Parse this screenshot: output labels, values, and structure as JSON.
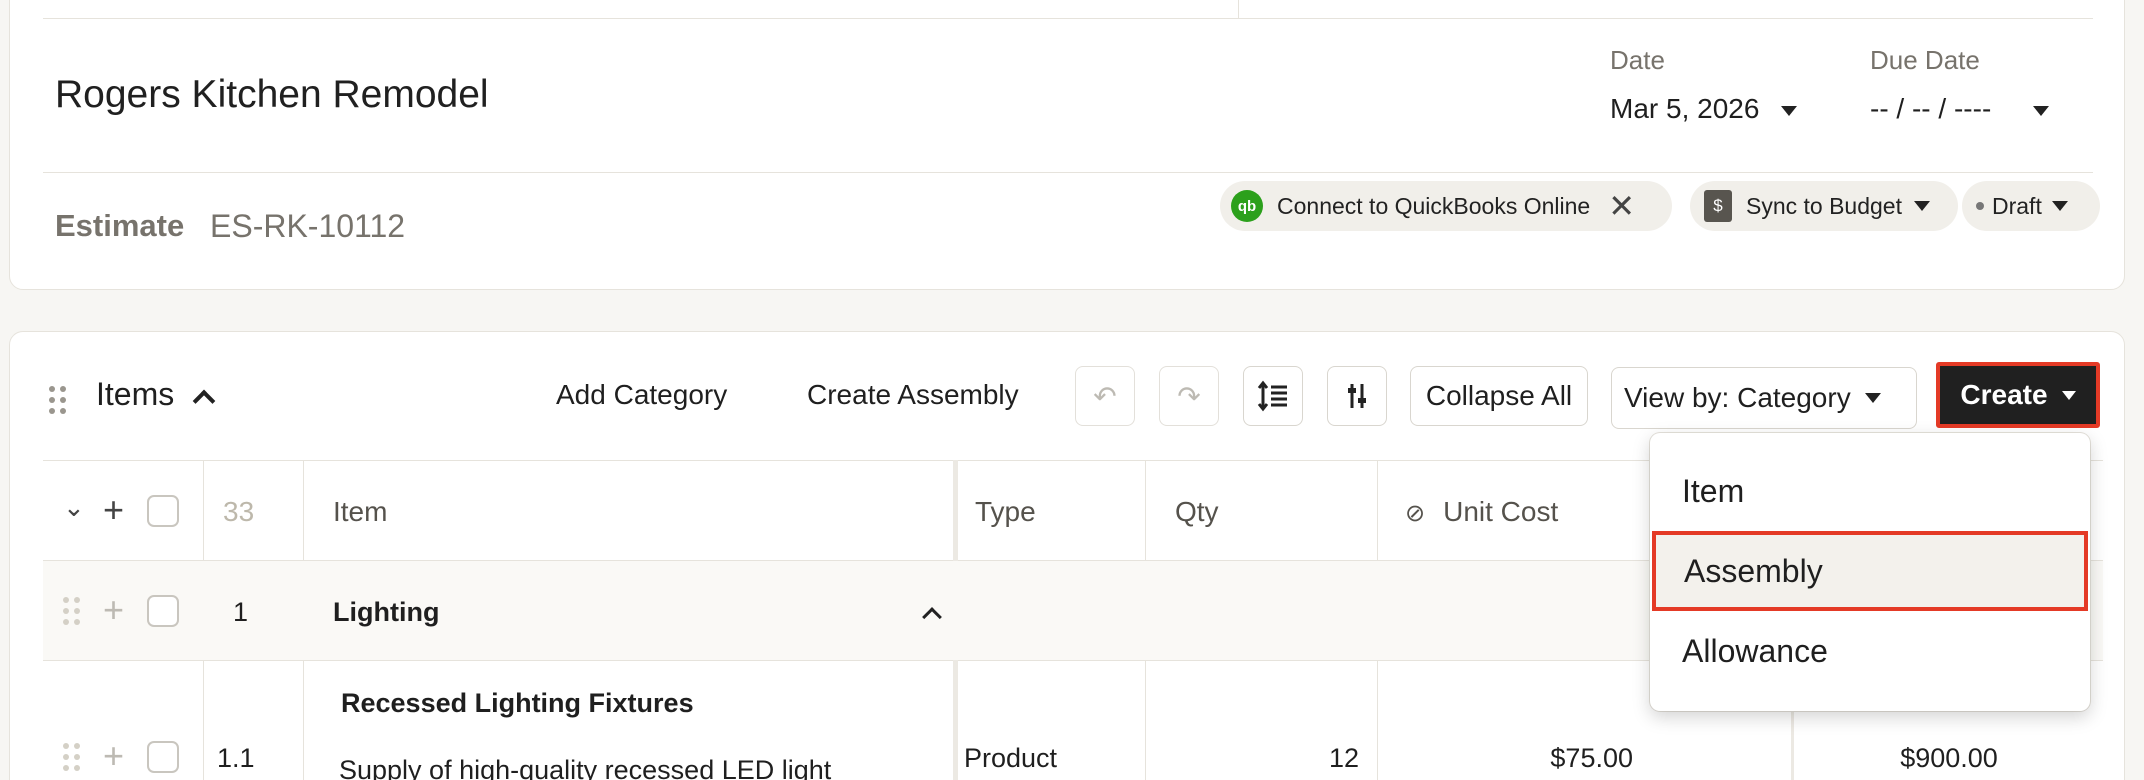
{
  "header": {
    "project_title": "Rogers Kitchen Remodel",
    "date_label": "Date",
    "date_value": "Mar 5, 2026",
    "due_date_label": "Due Date",
    "due_date_value": "-- / -- / ----",
    "estimate_label": "Estimate",
    "estimate_number": "ES-RK-10112",
    "quickbooks_label": "Connect to QuickBooks Online",
    "quickbooks_icon_text": "qb",
    "sync_label": "Sync to Budget",
    "status_label": "Draft"
  },
  "items_section": {
    "title": "Items",
    "add_category": "Add Category",
    "create_assembly": "Create Assembly",
    "collapse_all": "Collapse All",
    "view_by": "View by: Category",
    "create": "Create"
  },
  "table": {
    "headers": {
      "count": "33",
      "item": "Item",
      "type": "Type",
      "qty": "Qty",
      "unit_cost": "Unit Cost"
    },
    "rows": [
      {
        "number": "1",
        "name": "Lighting"
      },
      {
        "number": "1.1",
        "name": "Recessed Lighting Fixtures",
        "description": "Supply of high-quality recessed LED light",
        "type": "Product",
        "qty": "12",
        "unit_cost": "$75.00",
        "total": "$900.00"
      }
    ]
  },
  "create_menu": {
    "items": [
      "Item",
      "Assembly",
      "Allowance"
    ],
    "selected": "Assembly"
  },
  "colors": {
    "highlight": "#e43a26",
    "quickbooks_green": "#2ca01c",
    "create_button": "#202020"
  }
}
